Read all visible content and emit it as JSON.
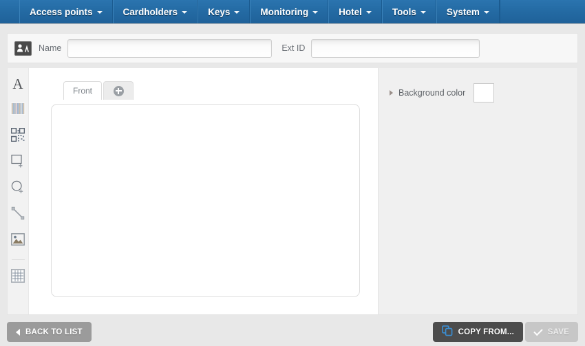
{
  "nav": {
    "items": [
      {
        "label": "Access points",
        "icon": "chevron-down-icon"
      },
      {
        "label": "Cardholders",
        "icon": "chevron-down-icon"
      },
      {
        "label": "Keys",
        "icon": "chevron-down-icon"
      },
      {
        "label": "Monitoring",
        "icon": "chevron-down-icon"
      },
      {
        "label": "Hotel",
        "icon": "chevron-down-icon"
      },
      {
        "label": "Tools",
        "icon": "chevron-down-icon"
      },
      {
        "label": "System",
        "icon": "chevron-down-icon"
      }
    ]
  },
  "header": {
    "icon": "card-template-icon",
    "name_label": "Name",
    "name_value": "",
    "name_placeholder": "",
    "extid_label": "Ext ID",
    "extid_value": "",
    "extid_placeholder": ""
  },
  "toolbar": {
    "tools": [
      {
        "name": "text-tool",
        "icon": "text-icon",
        "glyph": "A"
      },
      {
        "name": "barcode-tool",
        "icon": "barcode-icon"
      },
      {
        "name": "qrcode-tool",
        "icon": "qrcode-icon"
      },
      {
        "name": "rectangle-tool",
        "icon": "rectangle-add-icon"
      },
      {
        "name": "ellipse-tool",
        "icon": "circle-add-icon"
      },
      {
        "name": "line-tool",
        "icon": "line-icon"
      },
      {
        "name": "image-tool",
        "icon": "image-icon"
      },
      {
        "name": "grid-tool",
        "icon": "grid-icon"
      }
    ]
  },
  "designer": {
    "tabs": [
      {
        "label": "Front",
        "active": true
      },
      {
        "label": "",
        "icon": "plus-icon",
        "active": false
      }
    ],
    "card_background": "#ffffff"
  },
  "properties": {
    "background_color_label": "Background color",
    "background_color_value": "#ffffff",
    "disclosure_icon": "chevron-right-icon"
  },
  "footer": {
    "back_label": "BACK TO LIST",
    "back_icon": "chevron-left-icon",
    "copy_label": "COPY FROM...",
    "copy_icon": "copy-icon",
    "save_label": "SAVE",
    "save_icon": "check-icon",
    "save_disabled": true
  },
  "colors": {
    "nav_blue": "#246ba4",
    "accent_blue": "#3a8fd4",
    "panel_gray": "#f0f0f0",
    "page_background": "#e8e8e8"
  }
}
